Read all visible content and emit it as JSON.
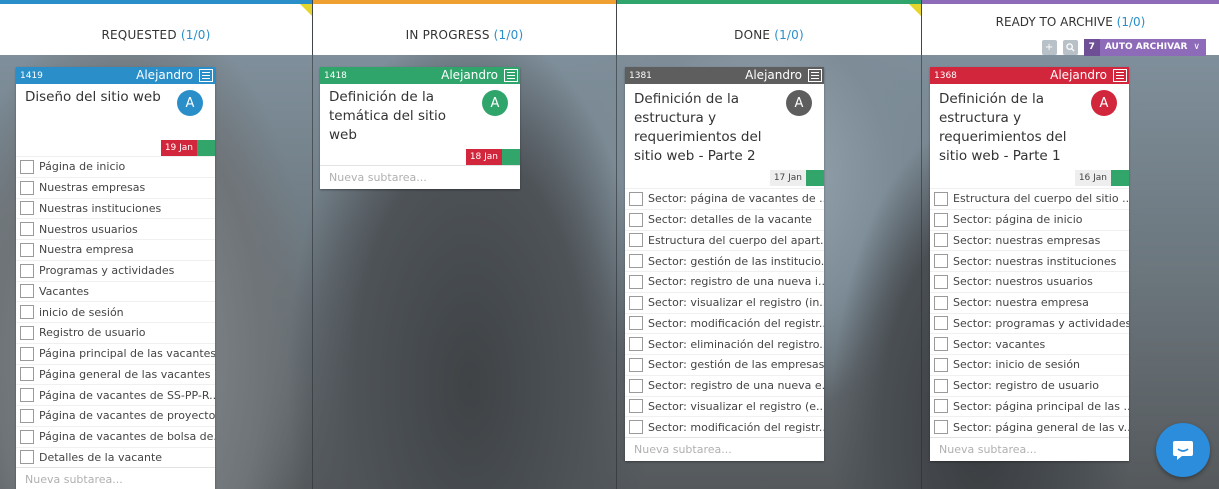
{
  "columns": [
    {
      "title": "REQUESTED",
      "count": "(1/0)",
      "color": "#2a8fc9"
    },
    {
      "title": "IN PROGRESS",
      "count": "(1/0)",
      "color": "#f0a030"
    },
    {
      "title": "DONE",
      "count": "(1/0)",
      "color": "#2fa56c"
    },
    {
      "title": "READY TO ARCHIVE",
      "count": "(1/0)",
      "color": "#8e6bb8"
    }
  ],
  "ready_tools": {
    "auto_number": "7",
    "auto_label": "AUTO ARCHIVAR"
  },
  "cards": [
    {
      "id": "1419",
      "owner": "Alejandro",
      "color": "#2a8fc9",
      "title": "Diseño del sitio web",
      "avatar": "A",
      "date": "19 Jan",
      "date_color": "#d2263c",
      "tasks": [
        "Página de inicio",
        "Nuestras empresas",
        "Nuestras instituciones",
        "Nuestros usuarios",
        "Nuestra empresa",
        "Programas y actividades",
        "Vacantes",
        "inicio de sesión",
        "Registro de usuario",
        "Página principal de las vacantes",
        "Página general de las vacantes",
        "Página de vacantes de SS-PP-R...",
        "Página de vacantes de proyectos",
        "Página de vacantes de bolsa de...",
        "Detalles de la vacante"
      ],
      "new_subtask": "Nueva subtarea..."
    },
    {
      "id": "1418",
      "owner": "Alejandro",
      "color": "#2fa56c",
      "title": "Definición de la temática del sitio web",
      "avatar": "A",
      "date": "18 Jan",
      "date_color": "#d2263c",
      "tasks": [],
      "new_subtask": "Nueva subtarea..."
    },
    {
      "id": "1381",
      "owner": "Alejandro",
      "color": "#5e5e5e",
      "title": "Definición de la estructura y requerimientos del sitio web - Parte 2",
      "avatar": "A",
      "date": "17 Jan",
      "date_color": "#eeeeee",
      "tasks": [
        "Sector: página de vacantes de ...",
        "Sector: detalles de la vacante",
        "Estructura del cuerpo del apart...",
        "Sector: gestión de las institucio...",
        "Sector: registro de una nueva i...",
        "Sector: visualizar el registro (in...",
        "Sector: modificación del registr...",
        "Sector: eliminación del registro...",
        "Sector: gestión de las empresas",
        "Sector: registro de una nueva e...",
        "Sector: visualizar el registro (e...",
        "Sector: modificación del registr..."
      ],
      "new_subtask": "Nueva subtarea..."
    },
    {
      "id": "1368",
      "owner": "Alejandro",
      "color": "#d2263c",
      "title": "Definición de la estructura y requerimientos del sitio web - Parte 1",
      "avatar": "A",
      "date": "16 Jan",
      "date_color": "#eeeeee",
      "tasks": [
        "Estructura del cuerpo del sitio ...",
        "Sector: página de inicio",
        "Sector: nuestras empresas",
        "Sector: nuestras instituciones",
        "Sector: nuestros usuarios",
        "Sector: nuestra empresa",
        "Sector: programas y actividades",
        "Sector: vacantes",
        "Sector: inicio de sesión",
        "Sector: registro de usuario",
        "Sector: página principal de las ...",
        "Sector: página general de las v..."
      ],
      "new_subtask": "Nueva subtarea..."
    }
  ]
}
